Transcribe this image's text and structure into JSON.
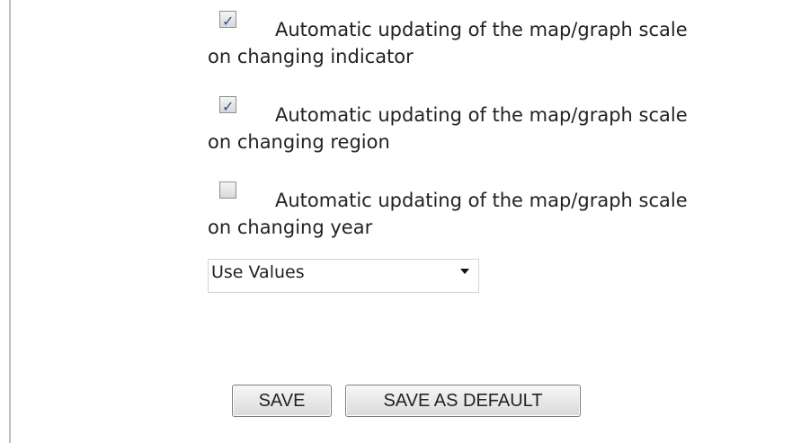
{
  "options": [
    {
      "checked": true,
      "label_line1": "Automatic updating of the map/graph scale",
      "label_line2": "on changing indicator"
    },
    {
      "checked": true,
      "label_line1": "Automatic updating of the map/graph scale",
      "label_line2": "on changing region"
    },
    {
      "checked": false,
      "label_line1": "Automatic updating of the map/graph scale",
      "label_line2": "on changing year"
    }
  ],
  "scale_select": {
    "selected": "Use Values"
  },
  "buttons": {
    "save": "SAVE",
    "save_as_default": "SAVE AS DEFAULT"
  }
}
